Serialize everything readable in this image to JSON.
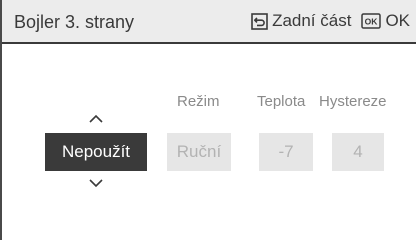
{
  "header": {
    "title": "Bojler 3. strany",
    "back_label": "Zadní část",
    "ok_label": "OK"
  },
  "columns": {
    "mode_label": "Režim",
    "temperature_label": "Teplota",
    "hysteresis_label": "Hystereze"
  },
  "values": {
    "selector_value": "Nepoužít",
    "mode_value": "Ruční",
    "temperature_value": "-7",
    "hysteresis_value": "4"
  },
  "icons": {
    "back": "return-icon",
    "ok": "ok-key-icon",
    "up": "chevron-up-icon",
    "down": "chevron-down-icon"
  },
  "colors": {
    "header_bg": "#ececec",
    "selected_bg": "#3a3a3a",
    "disabled_bg": "#e6e6e6",
    "disabled_text": "#b3b3b3"
  }
}
